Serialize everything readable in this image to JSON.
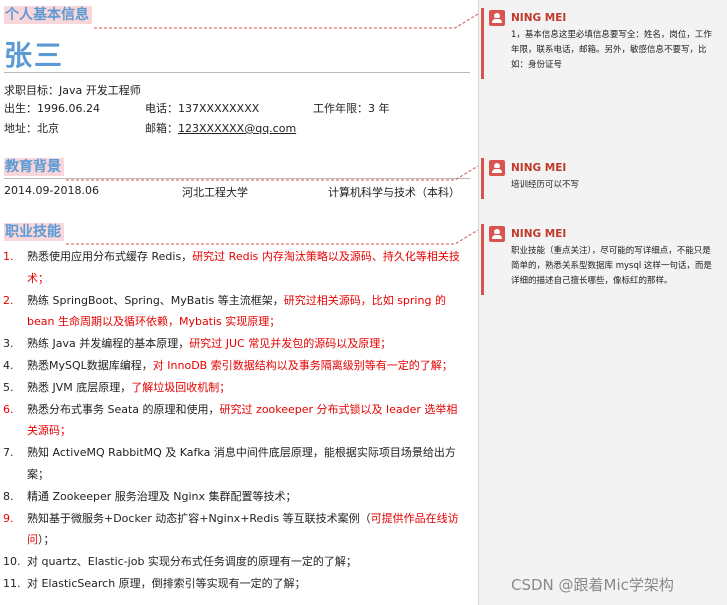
{
  "basic": {
    "section_title": "个人基本信息",
    "name": "张三",
    "objective": "求职目标：Java 开发工程师",
    "birth": "出生：1996.06.24",
    "phone": "电话：137XXXXXXXX",
    "years": "工作年限：3 年",
    "address": "地址：北京",
    "email_label": "邮箱：",
    "email": "123XXXXXX@qq.com"
  },
  "education": {
    "section_title": "教育背景",
    "period": "2014.09-2018.06",
    "school": "河北工程大学",
    "major": "计算机科学与技术（本科）"
  },
  "skills": {
    "section_title": "职业技能",
    "items": [
      {
        "num": "1.",
        "a": "熟悉使用应用分布式缓存 Redis，",
        "b": "研究过 Redis 内存淘汰策略以及源码、持久化等相关技术；"
      },
      {
        "num": "2.",
        "a": "熟练 SpringBoot、Spring、MyBatis 等主流框架，",
        "b": "研究过相关源码，比如 spring 的 bean 生命周期以及循环依赖，Mybatis 实现原理；"
      },
      {
        "num": "3.",
        "a": "熟练 Java 并发编程的基本原理，",
        "b": "研究过 JUC 常见并发包的源码以及原理；"
      },
      {
        "num": "4.",
        "a": "熟悉MySQL数据库编程，",
        "b": "对 InnoDB 索引数据结构以及事务隔离级别等有一定的了解；"
      },
      {
        "num": "5.",
        "a": "熟悉 JVM 底层原理，",
        "b": "了解垃圾回收机制；"
      },
      {
        "num": "6.",
        "a": "熟悉分布式事务 Seata 的原理和使用，",
        "b": "研究过 zookeeper 分布式锁以及 leader 选举相关源码；"
      },
      {
        "num": "7.",
        "a": "熟知 ActiveMQ RabbitMQ 及 Kafka 消息中间件底层原理，能根据实际项目场景给出方案；",
        "b": ""
      },
      {
        "num": "8.",
        "a": "精通 Zookeeper 服务治理及 Nginx 集群配置等技术；",
        "b": ""
      },
      {
        "num": "9.",
        "a": "熟知基于微服务+Docker 动态扩容+Nginx+Redis 等互联技术案例（",
        "b": "可提供作品在线访问",
        "c": "）；"
      },
      {
        "num": "10.",
        "a": "对 quartz、Elastic-job 实现分布式任务调度的原理有一定的了解；",
        "b": ""
      },
      {
        "num": "11.",
        "a": "对 ElasticSearch 原理，倒排索引等实现有一定的了解；",
        "b": ""
      }
    ]
  },
  "comments": [
    {
      "author": "NING MEI",
      "text": "1，基本信息这里必填信息要写全：姓名，岗位，工作年限，联系电话，邮箱。另外，敏感信息不要写，比如：身份证号"
    },
    {
      "author": "NING MEI",
      "text": "培训经历可以不写"
    },
    {
      "author": "NING MEI",
      "text": "职业技能（重点关注），尽可能的写详细点，不能只是简单的，熟悉关系型数据库 mysql 这样一句话，而是详细的描述自己擅长哪些，像标红的那样。"
    }
  ],
  "watermark": "CSDN @跟着Mic学架构",
  "colors": {
    "heading": "#5b9bd5",
    "highlight_red": "#e60000",
    "comment_accent": "#d9534f"
  }
}
